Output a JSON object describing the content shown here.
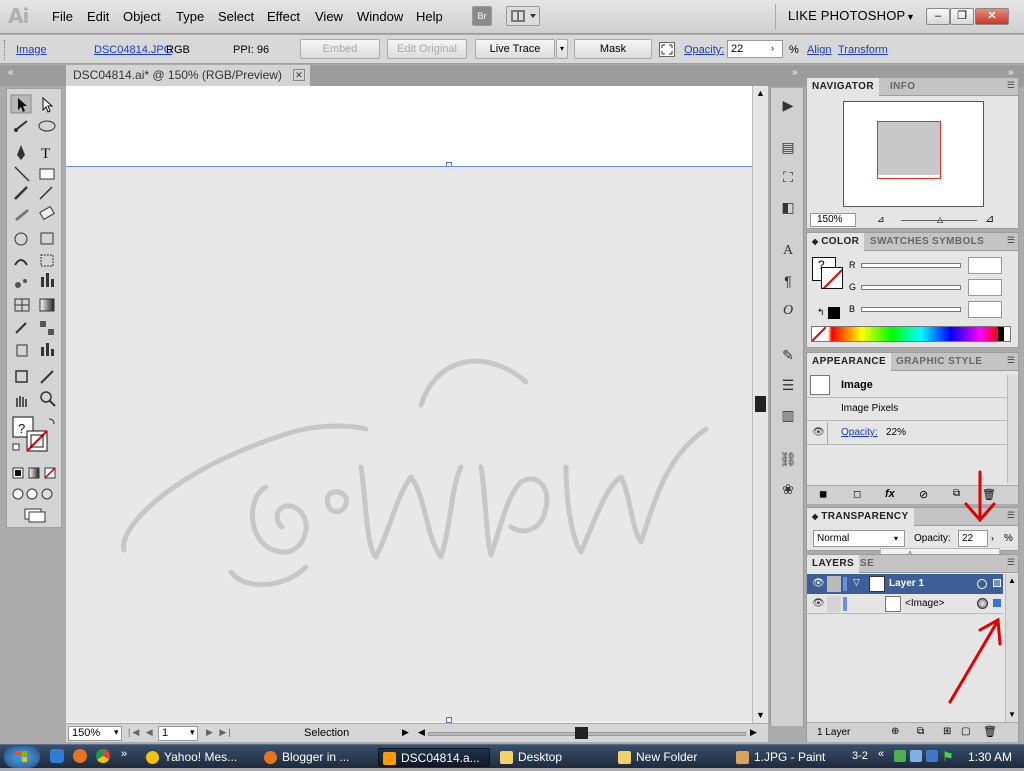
{
  "app": {
    "logo": "Ai"
  },
  "menus": [
    "File",
    "Edit",
    "Object",
    "Type",
    "Select",
    "Effect",
    "View",
    "Window",
    "Help"
  ],
  "header": {
    "bridge": "Br",
    "workspace": "LIKE PHOTOSHOP",
    "min": "–",
    "restore": "❐",
    "close": "✕"
  },
  "control": {
    "type_label": "Image",
    "filename": "DSC04814.JPG",
    "color_mode": "RGB",
    "ppi": "PPI: 96",
    "embed": "Embed",
    "edit_original": "Edit Original",
    "live_trace": "Live Trace",
    "mask": "Mask",
    "opacity_label": "Opacity:",
    "opacity_value": "22",
    "percent": "%",
    "align": "Align",
    "transform": "Transform"
  },
  "document": {
    "tab_title": "DSC04814.ai* @ 150% (RGB/Preview)",
    "artwork_text": "สุพิศม"
  },
  "status": {
    "zoom": "150%",
    "page": "1",
    "tool": "Selection"
  },
  "navigator": {
    "tabs": [
      "NAVIGATOR",
      "INFO"
    ],
    "zoom": "150%"
  },
  "color": {
    "tabs": [
      "COLOR",
      "SWATCHES",
      "SYMBOLS"
    ],
    "channels": [
      "R",
      "G",
      "B"
    ]
  },
  "appearance": {
    "tabs": [
      "APPEARANCE",
      "GRAPHIC STYLE"
    ],
    "object": "Image",
    "rows": [
      {
        "label": "Image Pixels"
      },
      {
        "label": "Opacity:",
        "value": "22%"
      }
    ]
  },
  "transparency": {
    "title": "TRANSPARENCY",
    "blend_mode": "Normal",
    "opacity_label": "Opacity:",
    "opacity_value": "22",
    "percent": "%"
  },
  "layers": {
    "tabs": [
      "LAYERS",
      "SE"
    ],
    "items": [
      {
        "name": "Layer 1"
      },
      {
        "name": "<Image>"
      }
    ],
    "footer": "1 Layer"
  },
  "taskbar": {
    "items": [
      "Yahoo! Mes...",
      "Blogger in ...",
      "DSC04814.a...",
      "Desktop",
      "New Folder",
      "1.JPG - Paint"
    ],
    "lang": "3-2",
    "clock": "1:30 AM"
  },
  "colors": {
    "accent_link": "#1a3dc9",
    "selection_blue": "#3d5f95",
    "annotation_red": "#e00000",
    "taskbar": "#1d2a3d"
  }
}
